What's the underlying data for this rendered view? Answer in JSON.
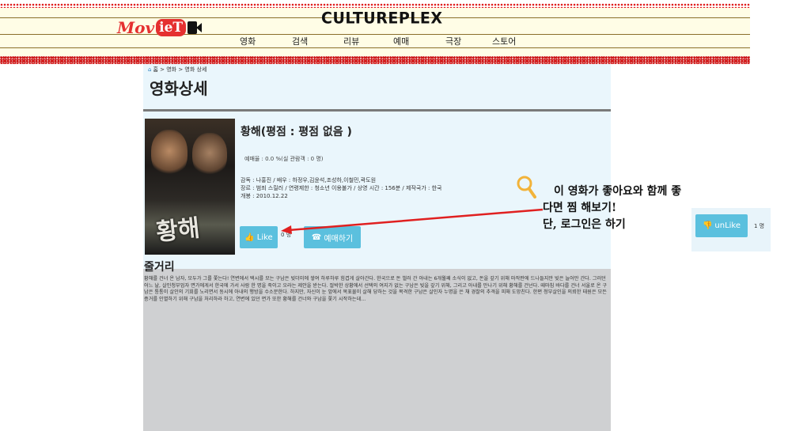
{
  "header": {
    "site_title": "CULTUREPLEX",
    "logo": {
      "part1": "Mov",
      "part2": "ieT",
      "icon": "camera-icon"
    },
    "nav": [
      "영화",
      "검색",
      "리뷰",
      "예매",
      "극장",
      "스토어"
    ]
  },
  "breadcrumb": {
    "home_icon": "home-icon",
    "text": "홈 > 영화 > 영화 상세"
  },
  "page_title": "영화상세",
  "movie": {
    "title": "황해(평점 : 평점 없음 )",
    "booking_rate": "예매율 : 0.0 %(실 관람객 : 0 명)",
    "credits_line1": "감독 : 나홍진 / 배우 : 하정우,김윤석,조성하,이철민,곽도원",
    "credits_line2": "장르 : 범죄 스릴러 / 연령제한 : 청소년 이용불가 / 상영 시간 : 156분 / 제작국가 : 한국",
    "credits_line3": "개봉 : 2010.12.22",
    "poster_text": "황해",
    "like_button": "Like",
    "like_icon": "thumbs-up-icon",
    "like_count": "0 명",
    "book_button": "예매하기",
    "book_icon": "phone-icon"
  },
  "plot": {
    "heading": "줄거리",
    "text": "황해를 건너 온 남자, 모두가 그를 쫓는다! 연변에서 택시를 모는 구남은 빚더미에 쌓여 하루하루 힘겹게 살아간다. 한국으로 돈 벌러 간 아내는 6개월째 소식이 없고, 돈을 갚기 위해 마작판에 드나들지만 빚은 늘어만 간다. 그러던 어느 날, 살인청부업자 면가에게서 한국에 가서 사람 한 명을 죽이고 오라는 제안을 받는다. 절박한 상황에서 선택의 여지가 없는 구남은 빚을 갚기 위해, 그리고 아내를 만나기 위해 황해를 건넌다. 때마침 바다를 건너 서울로 온 구남은 통통이 살인의 기회를 노리면서 동시에 아내의 행방을 수소문한다. 하지만, 자신이 눈 앞에서 목표물이 살해 당하는 것을 목격한 구남은 살인자 누명을 쓴 채 경찰의 추격을 피해 도망친다. 한편 청부살인을 의뢰한 태원은 모든 증거를 인멸하기 위해 구남을 처리하라 하고, 연변에 있던 면가 또한 황해를 건너와 구남을 쫓기 시작하는데..."
  },
  "annotation": {
    "icon": "magnifier-icon",
    "line1": "이 영화가 좋아요와 함께 좋",
    "line2": "다면 찜 해보기!",
    "line3": "단, 로그인은 하기",
    "arrow_color": "#e02020",
    "unlike_button": "unLike",
    "unlike_icon": "thumbs-down-icon",
    "unlike_count": "1 명"
  },
  "colors": {
    "button": "#5bc0de",
    "hero_bg": "#eaf6fc",
    "band": "#e02020"
  }
}
